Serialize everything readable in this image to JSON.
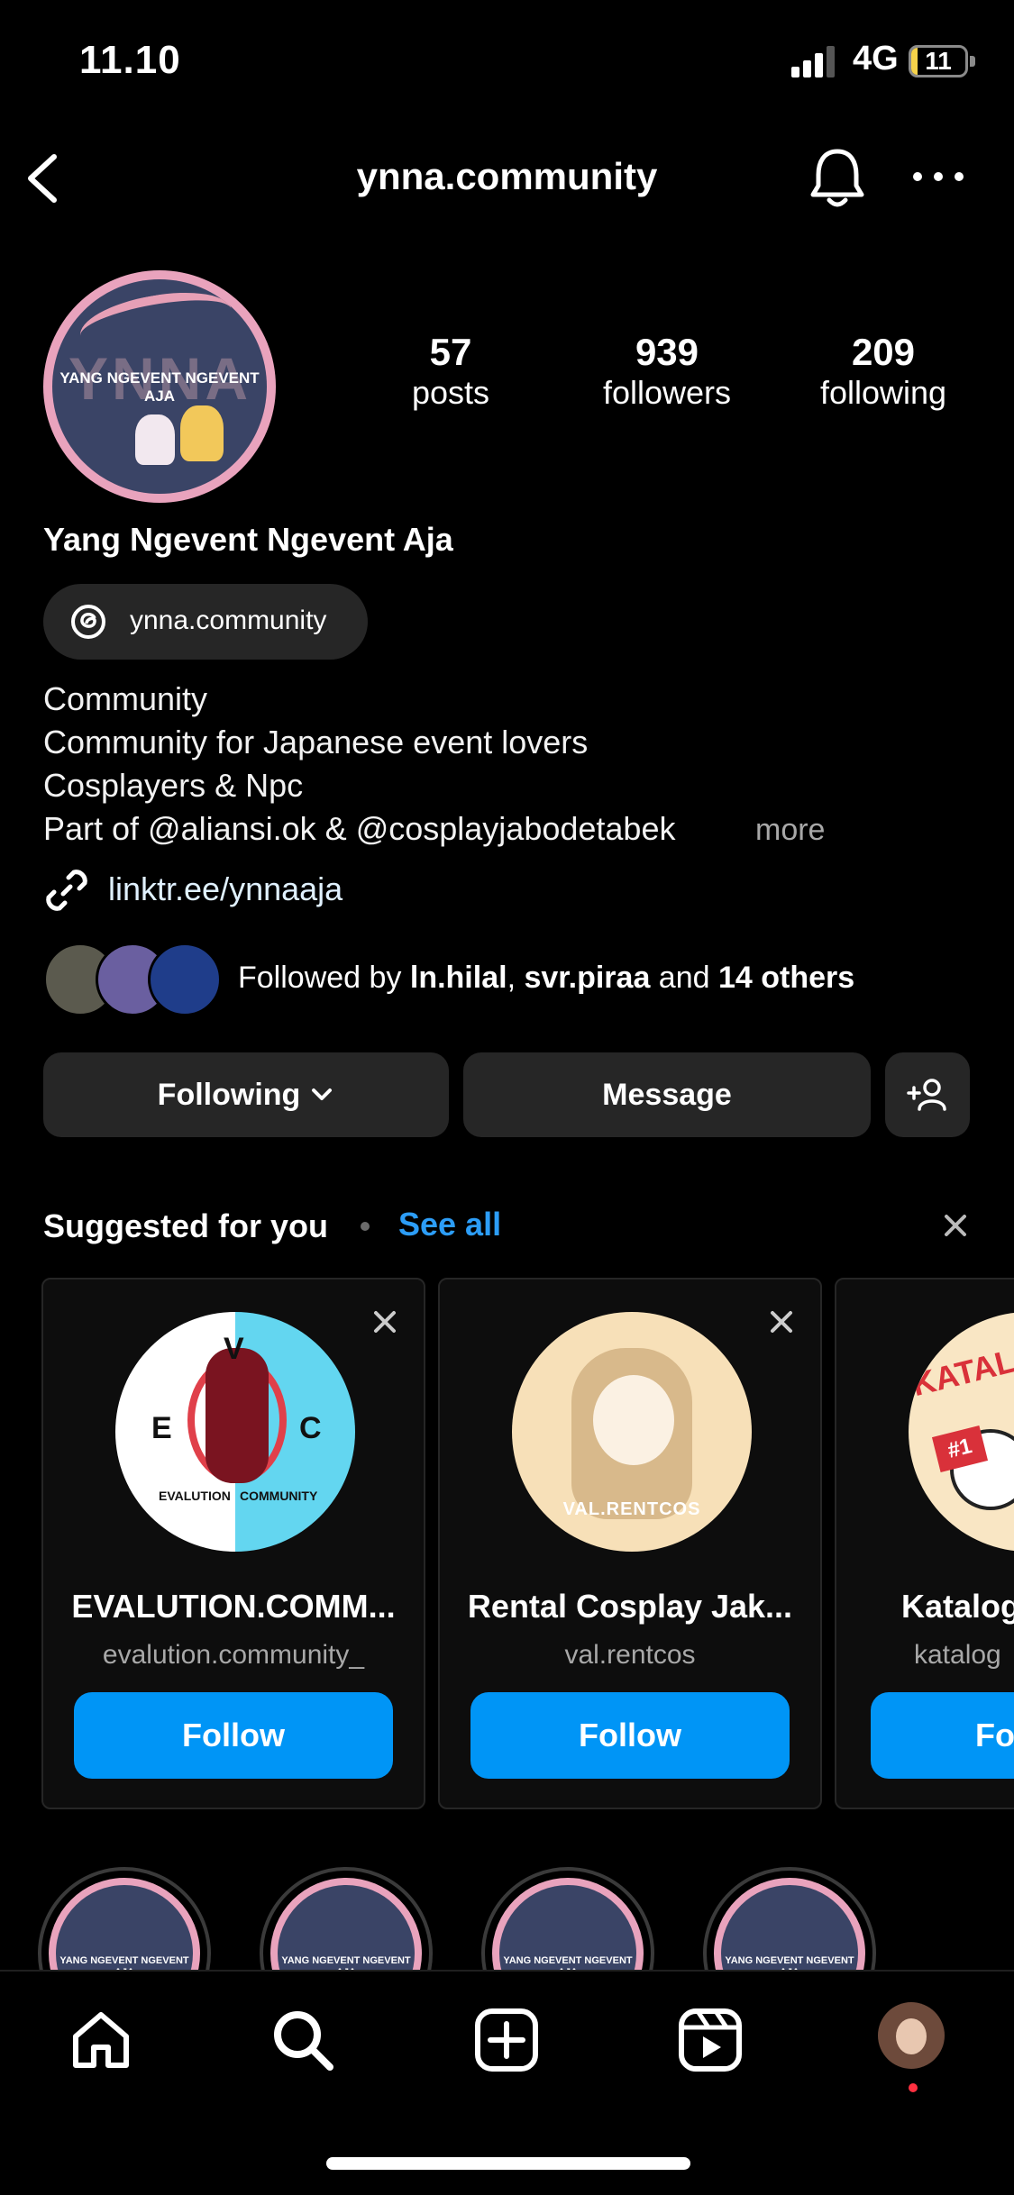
{
  "status": {
    "time": "11.10",
    "network": "4G",
    "battery": "11"
  },
  "header": {
    "title": "ynna.community"
  },
  "profile": {
    "avatar_text": "YANG NGEVENT NGEVENT AJA",
    "avatar_bg": "YNNA",
    "stats": [
      {
        "num": "57",
        "label": "posts"
      },
      {
        "num": "939",
        "label": "followers"
      },
      {
        "num": "209",
        "label": "following"
      }
    ],
    "name": "Yang Ngevent Ngevent Aja",
    "threads_handle": "ynna.community",
    "bio": [
      "Community",
      "Community for Japanese event lovers",
      "Cosplayers & Npc",
      "Part of  @aliansi.ok & @cosplayjabodetabek"
    ],
    "bio_more": "more",
    "link": "linktr.ee/ynnaaja",
    "followed_by": {
      "prefix": "Followed by ",
      "user1": "ln.hilal",
      "sep": ", ",
      "user2": "svr.piraa",
      "and": " and ",
      "others": "14 others"
    }
  },
  "actions": {
    "following": "Following",
    "message": "Message"
  },
  "suggested": {
    "title": "Suggested for you",
    "see_all": "See all",
    "cards": [
      {
        "name": "EVALUTION.COMM...",
        "username": "evalution.community_",
        "follow": "Follow",
        "pic_text_v": "V",
        "pic_text_e": "E",
        "pic_text_c": "C",
        "pic_caption_left": "EVALUTION",
        "pic_caption_right": "COMMUNITY"
      },
      {
        "name": "Rental Cosplay Jak...",
        "username": "val.rentcos",
        "follow": "Follow",
        "pic_caption": "VAL.RENTCOS"
      },
      {
        "name": "Katalog",
        "username": "katalog",
        "follow": "Fo",
        "pic_text": "KATALOG",
        "pic_badge": "#1"
      }
    ]
  },
  "highlights": {
    "caption": "YANG NGEVENT NGEVENT AJA"
  },
  "colors": {
    "accent": "#0095f6",
    "link": "#2c9df7",
    "surface": "#262626"
  }
}
